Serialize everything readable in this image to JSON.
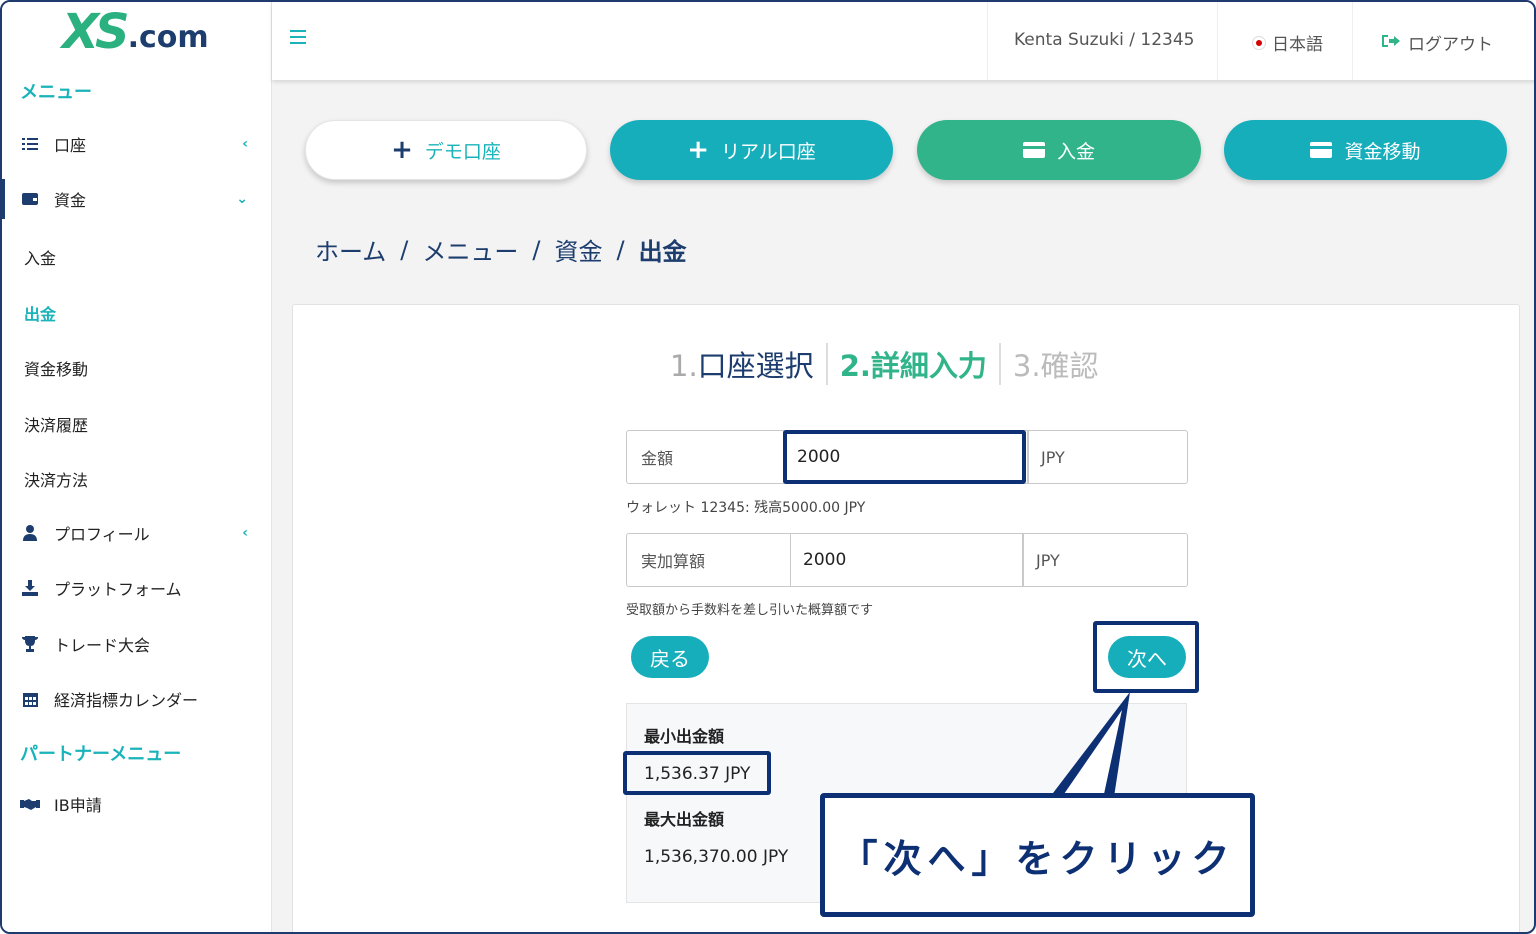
{
  "logo": {
    "mark": "XS",
    "suffix": ".com"
  },
  "sidebar": {
    "menu_heading": "メニュー",
    "items": [
      {
        "label": "口座",
        "icon": "list-icon",
        "chevron": "‹"
      },
      {
        "label": "資金",
        "icon": "wallet-icon",
        "chevron": "⌄"
      },
      {
        "label": "プロフィール",
        "icon": "user-icon",
        "chevron": "‹"
      },
      {
        "label": "プラットフォーム",
        "icon": "download-icon"
      },
      {
        "label": "トレード大会",
        "icon": "trophy-icon"
      },
      {
        "label": "経済指標カレンダー",
        "icon": "calendar-icon"
      }
    ],
    "sub_items": [
      "入金",
      "出金",
      "資金移動",
      "決済履歴",
      "決済方法"
    ],
    "partner_heading": "パートナーメニュー",
    "partner_items": [
      {
        "label": "IB申請",
        "icon": "handshake-icon"
      }
    ]
  },
  "header": {
    "user": "Kenta Suzuki / 12345",
    "language": "日本語",
    "logout": "ログアウト"
  },
  "top_buttons": {
    "demo": "デモ口座",
    "real": "リアル口座",
    "deposit": "入金",
    "transfer": "資金移動"
  },
  "breadcrumb": [
    "ホーム",
    "メニュー",
    "資金",
    "出金"
  ],
  "steps": {
    "step1_num": "1.",
    "step1_label": "口座選択",
    "step2": "2.詳細入力",
    "step3": "3.確認"
  },
  "form": {
    "amount_label": "金額",
    "amount_value": "2000",
    "amount_unit": "JPY",
    "wallet_note": "ウォレット 12345: 残高5000.00 JPY",
    "actual_label": "実加算額",
    "actual_value": "2000",
    "actual_unit": "JPY",
    "estimate_note": "受取額から手数料を差し引いた概算額です",
    "back_button": "戻る",
    "next_button": "次へ"
  },
  "limits": {
    "min_title": "最小出金額",
    "min_value": "1,536.37 JPY",
    "max_title": "最大出金額",
    "max_value": "1,536,370.00 JPY"
  },
  "callout": {
    "text": "「次へ」をクリック"
  },
  "colors": {
    "teal": "#17aebc",
    "green": "#31b48a",
    "navy": "#1c3d6e",
    "highlight": "#0d2f73"
  }
}
